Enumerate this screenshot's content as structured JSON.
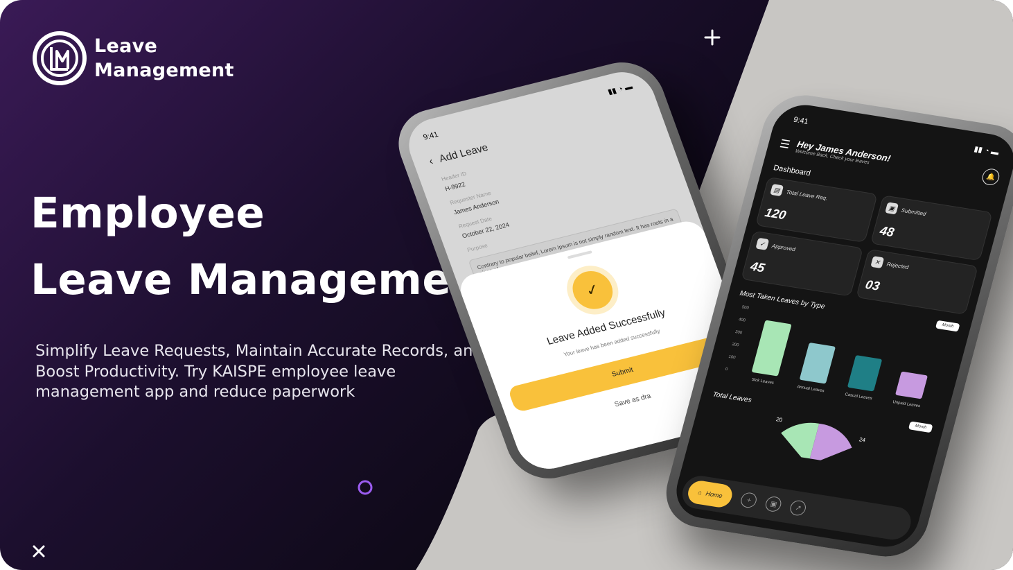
{
  "brand": {
    "line1": "Leave",
    "line2": "Management",
    "mark": "LM"
  },
  "hero": {
    "title_line1": "Employee",
    "title_line2": "Leave Management",
    "subtitle": "Simplify Leave Requests, Maintain Accurate Records, and Boost Productivity. Try KAISPE employee leave management app and reduce paperwork"
  },
  "phone_add_leave": {
    "time": "9:41",
    "title": "Add Leave",
    "fields": [
      {
        "label": "Header ID",
        "value": "H-9922"
      },
      {
        "label": "Requester Name",
        "value": "James Anderson"
      },
      {
        "label": "Request Date",
        "value": "October 22, 2024"
      }
    ],
    "purpose_label": "Purpose",
    "purpose_text": "Contrary to popular belief, Lorem Ipsum is not simply random text. It has roots in a piece of",
    "success_title": "Leave Added Successfully",
    "success_text": "Your leave has been added successfully",
    "submit_label": "Submit",
    "draft_label": "Save as dra"
  },
  "phone_dashboard": {
    "time": "9:41",
    "greeting": "Hey James Anderson!",
    "greeting_sub": "Welcome Back, Check your leaves",
    "dashboard_title": "Dashboard",
    "tiles": [
      {
        "label": "Total Leave Req.",
        "value": "120"
      },
      {
        "label": "Submitted",
        "value": "48"
      },
      {
        "label": "Approved",
        "value": "45"
      },
      {
        "label": "Rejected",
        "value": "03"
      }
    ],
    "chart_title": "Most Taken Leaves by Type",
    "period": "Month",
    "total_title": "Total Leaves",
    "total_period": "Month",
    "pie_labels": [
      "20",
      "24",
      "20"
    ],
    "nav_home": "Home"
  },
  "chart_data": {
    "type": "bar",
    "title": "Most Taken Leaves by Type",
    "categories": [
      "Sick Leaves",
      "Annual Leaves",
      "Casual Leaves",
      "Unpaid Leaves"
    ],
    "values": [
      420,
      300,
      260,
      190
    ],
    "ylim": [
      0,
      500
    ],
    "yticks": [
      "500",
      "400",
      "300",
      "200",
      "100",
      "0"
    ],
    "colors": [
      "#a8e6b5",
      "#8ec8cc",
      "#1f7f86",
      "#c79ae0"
    ]
  },
  "colors": {
    "accent": "#f9c13b",
    "bg_dark": "#0b0812",
    "bg_purple": "#3a1a56",
    "bg_grey": "#c8c6c3",
    "deco_circle": "#9b5cf0"
  }
}
